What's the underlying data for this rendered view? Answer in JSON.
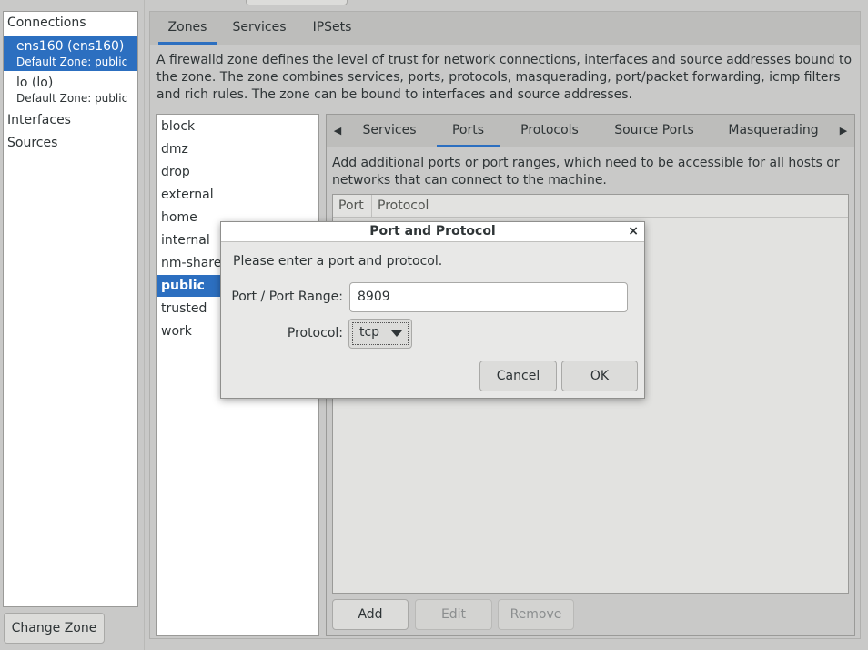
{
  "left": {
    "connections_header": "Connections",
    "connections": [
      {
        "name": "ens160 (ens160)",
        "sub": "Default Zone: public",
        "selected": true
      },
      {
        "name": "lo (lo)",
        "sub": "Default Zone: public",
        "selected": false
      }
    ],
    "interfaces_label": "Interfaces",
    "sources_label": "Sources",
    "change_zone_label": "Change Zone"
  },
  "main_tabs": [
    {
      "label": "Zones",
      "active": true
    },
    {
      "label": "Services",
      "active": false
    },
    {
      "label": "IPSets",
      "active": false
    }
  ],
  "zone_description": "A firewalld zone defines the level of trust for network connections, interfaces and source addresses bound to the zone. The zone combines services, ports, protocols, masquerading, port/packet forwarding, icmp filters and rich rules. The zone can be bound to interfaces and source addresses.",
  "zones": [
    {
      "label": "block",
      "selected": false
    },
    {
      "label": "dmz",
      "selected": false
    },
    {
      "label": "drop",
      "selected": false
    },
    {
      "label": "external",
      "selected": false
    },
    {
      "label": "home",
      "selected": false
    },
    {
      "label": "internal",
      "selected": false
    },
    {
      "label": "nm-shared",
      "selected": false
    },
    {
      "label": "public",
      "selected": true
    },
    {
      "label": "trusted",
      "selected": false
    },
    {
      "label": "work",
      "selected": false
    }
  ],
  "zone_tabs": [
    {
      "label": "Services",
      "active": false
    },
    {
      "label": "Ports",
      "active": true
    },
    {
      "label": "Protocols",
      "active": false
    },
    {
      "label": "Source Ports",
      "active": false
    },
    {
      "label": "Masquerading",
      "active": false
    }
  ],
  "arrows": {
    "left": "◀",
    "right": "▶"
  },
  "ports": {
    "description": "Add additional ports or port ranges, which need to be accessible for all hosts or networks that can connect to the machine.",
    "col_port": "Port",
    "col_protocol": "Protocol",
    "add_label": "Add",
    "edit_label": "Edit",
    "remove_label": "Remove"
  },
  "dialog": {
    "title": "Port and Protocol",
    "close_glyph": "×",
    "prompt": "Please enter a port and protocol.",
    "port_label": "Port / Port Range:",
    "port_value": "8909",
    "protocol_label": "Protocol:",
    "protocol_value": "tcp",
    "cancel_label": "Cancel",
    "ok_label": "OK"
  },
  "colors": {
    "accent": "#2c6fc0"
  }
}
